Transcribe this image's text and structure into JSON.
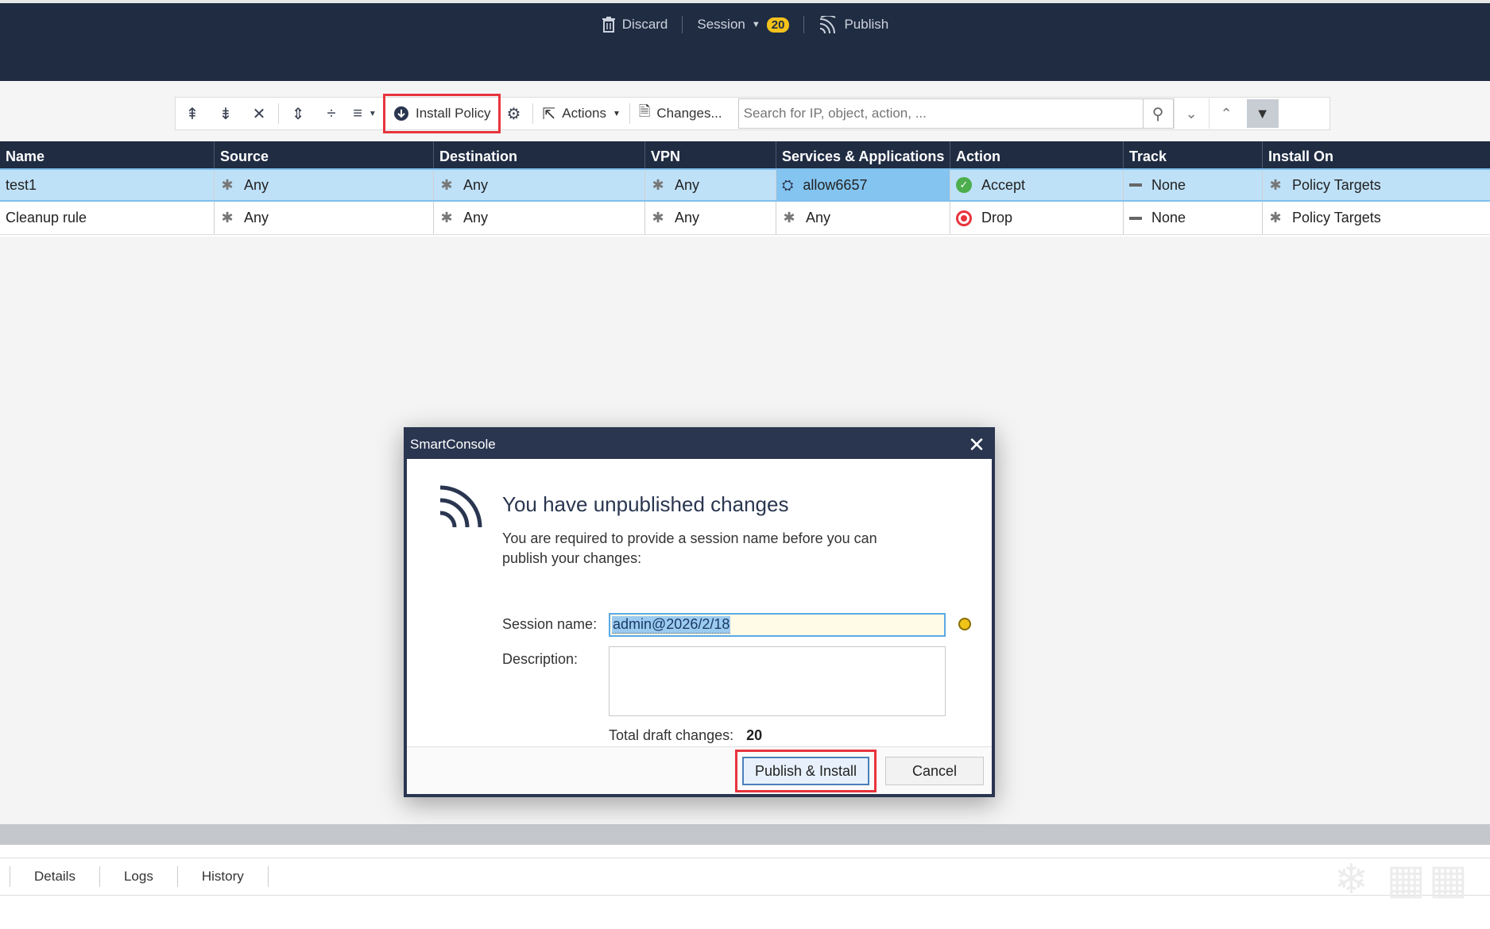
{
  "header": {
    "discard_label": "Discard",
    "session_label": "Session",
    "session_count": "20",
    "publish_label": "Publish"
  },
  "toolbar": {
    "install_policy_label": "Install Policy",
    "actions_label": "Actions",
    "changes_label": "Changes...",
    "search_placeholder": "Search for IP, object, action, ..."
  },
  "table": {
    "columns": [
      "Name",
      "Source",
      "Destination",
      "VPN",
      "Services & Applications",
      "Action",
      "Track",
      "Install On"
    ],
    "rows": [
      {
        "name": "test1",
        "source": "Any",
        "destination": "Any",
        "vpn": "Any",
        "services": "allow6657",
        "action": "Accept",
        "track": "None",
        "install_on": "Policy Targets"
      },
      {
        "name": "Cleanup rule",
        "source": "Any",
        "destination": "Any",
        "vpn": "Any",
        "services": "Any",
        "action": "Drop",
        "track": "None",
        "install_on": "Policy Targets"
      }
    ]
  },
  "bottom_tabs": [
    "Details",
    "Logs",
    "History"
  ],
  "dialog": {
    "title": "SmartConsole",
    "heading": "You have unpublished changes",
    "message": "You are required to provide a session name before you can publish your changes:",
    "session_name_label": "Session name:",
    "session_name_value": "admin@2026/2/18",
    "description_label": "Description:",
    "total_label": "Total draft changes:",
    "total_value": "20",
    "primary_button": "Publish & Install",
    "cancel_button": "Cancel"
  },
  "colors": {
    "header_bg": "#1f2c42",
    "highlight_red": "#e8343c",
    "selected_row": "#bfe1f8",
    "badge": "#f3c21b"
  }
}
